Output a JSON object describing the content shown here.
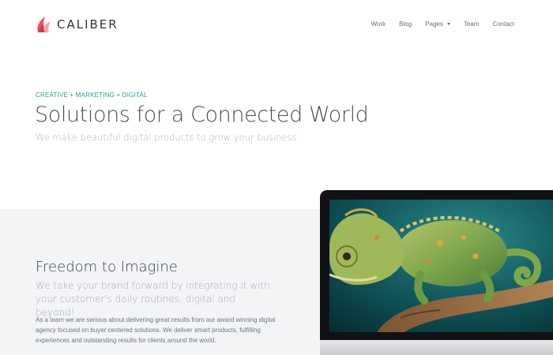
{
  "brand": {
    "name": "CALIBER",
    "logo_icon": "flame-leaf-logo",
    "logo_colors": [
      "#e8505b",
      "#f5a3a8"
    ]
  },
  "nav": {
    "items": [
      {
        "label": "Work"
      },
      {
        "label": "Blog"
      },
      {
        "label": "Pages",
        "dropdown": true
      },
      {
        "label": "Team"
      },
      {
        "label": "Contact"
      }
    ]
  },
  "hero": {
    "eyebrow": "CREATIVE + MARKETING + DIGITAL",
    "title": "Solutions for a Connected World",
    "subtitle": "We make beautiful digital products to grow your business."
  },
  "feature": {
    "title": "Freedom to Imagine",
    "lead": "We take your brand forward by integrating it with your customer's daily routines, digital and beyond!",
    "body": "As a team we are serious about delivering great results from our award winning digital agency focused on buyer centered solutions. We deliver smart products, fulfilling experiences and outstanding results for clients around the world."
  },
  "device": {
    "image": "chameleon-on-branch"
  },
  "colors": {
    "accent": "#2a9d8f",
    "band_background": "#f3f4f6"
  }
}
